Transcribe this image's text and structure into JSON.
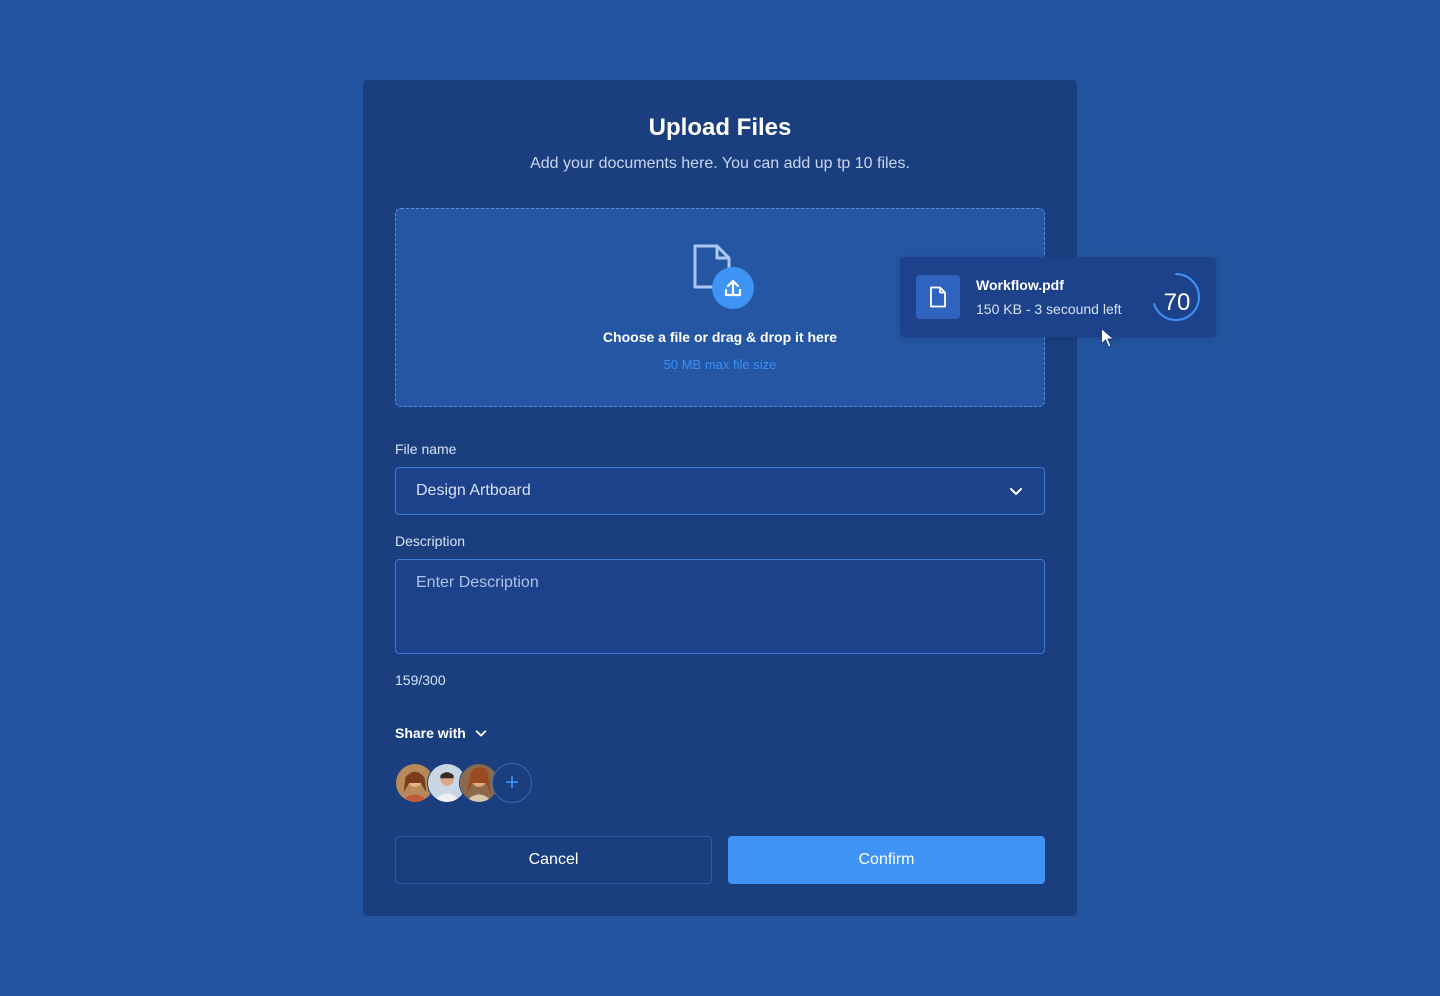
{
  "modal": {
    "title": "Upload Files",
    "subtitle": "Add your documents here. You can add up tp 10 files."
  },
  "dropzone": {
    "primary": "Choose a file or drag & drop it here",
    "secondary": "50 MB max file size"
  },
  "file_name": {
    "label": "File name",
    "value": "Design Artboard"
  },
  "description": {
    "label": "Description",
    "placeholder": "Enter Description",
    "counter": "159/300"
  },
  "share": {
    "label": "Share with",
    "add_symbol": "+"
  },
  "buttons": {
    "cancel": "Cancel",
    "confirm": "Confirm"
  },
  "upload": {
    "file_name": "Workflow.pdf",
    "meta": "150 KB - 3 secound left",
    "progress": "70",
    "progress_percent": 70
  },
  "colors": {
    "background": "#2254a0",
    "modal": "#1b3f7e",
    "accent": "#3e93f5"
  },
  "icons": {
    "file_upload": "file-upload-icon",
    "chevron": "chevron-down-icon",
    "file": "file-icon",
    "cursor": "cursor-icon"
  }
}
